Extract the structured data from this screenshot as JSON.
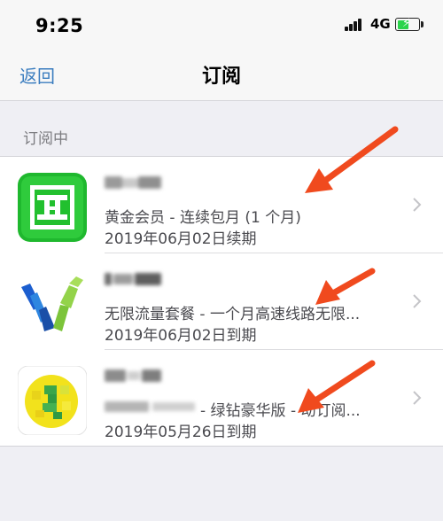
{
  "status_bar": {
    "time": "9:25",
    "network": "4G",
    "battery_level": 0.55,
    "battery_color": "#2bd44b"
  },
  "nav": {
    "back_label": "返回",
    "title": "订阅",
    "accent_color": "#3b7dbf"
  },
  "section": {
    "header": "订阅中"
  },
  "subscriptions": [
    {
      "app_name": "",
      "plan": "黄金会员 - 连续包月 (1 个月)",
      "renewal": "2019年06月02日续期",
      "icon": "green-reader-app-icon"
    },
    {
      "app_name": "",
      "plan": "无限流量套餐 - 一个月高速线路无限...",
      "renewal": "2019年06月02日到期",
      "icon": "vpn-v-logo-app-icon"
    },
    {
      "app_name": "",
      "plan": "- 绿钻豪华版 - 动订阅...",
      "renewal": "2019年05月26日到期",
      "icon": "music-green-diamond-app-icon"
    }
  ],
  "annotation_color": "#f04a1e"
}
